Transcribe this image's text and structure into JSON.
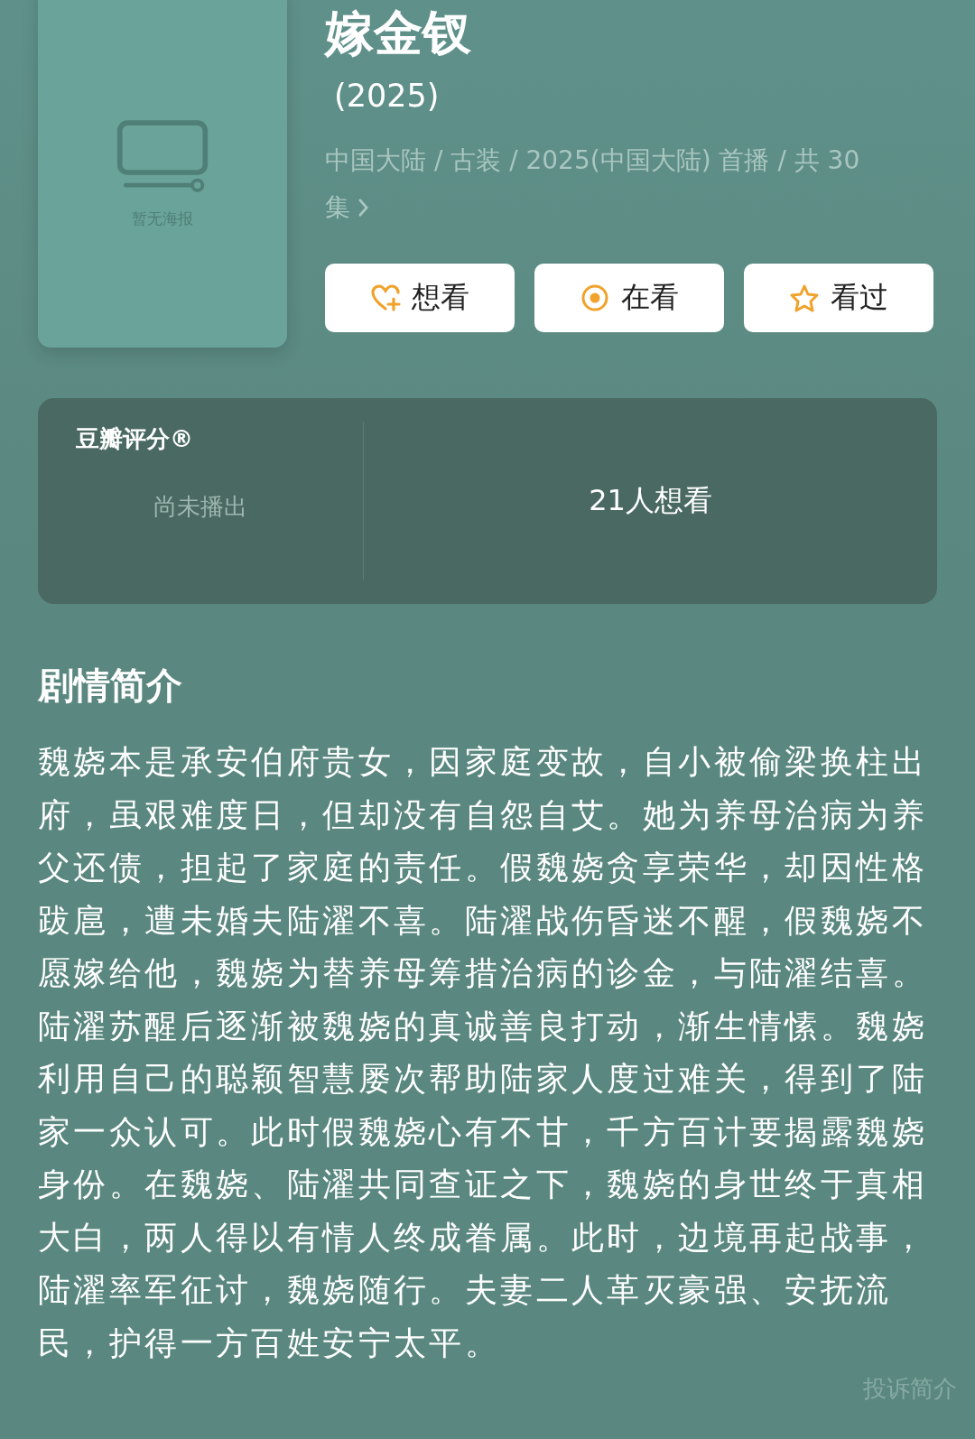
{
  "poster": {
    "placeholder": "暂无海报"
  },
  "title": "嫁金钗",
  "year": "(2025)",
  "meta": "中国大陆 / 古装 / 2025(中国大陆) 首播 / 共 30 集",
  "actions": [
    {
      "label": "想看",
      "kind": "heart"
    },
    {
      "label": "在看",
      "kind": "dot"
    },
    {
      "label": "看过",
      "kind": "star"
    }
  ],
  "rating": {
    "label": "豆瓣评分®",
    "status": "尚未播出",
    "wish_count": "21人想看"
  },
  "synopsis": {
    "heading": "剧情简介",
    "text": "魏娆本是承安伯府贵女，因家庭变故，自小被偷梁换柱出府，虽艰难度日，但却没有自怨自艾。她为养母治病为养父还债，担起了家庭的责任。假魏娆贪享荣华，却因性格跋扈，遭未婚夫陆濯不喜。陆濯战伤昏迷不醒，假魏娆不愿嫁给他，魏娆为替养母筹措治病的诊金，与陆濯结喜。陆濯苏醒后逐渐被魏娆的真诚善良打动，渐生情愫。魏娆利用自己的聪颖智慧屡次帮助陆家人度过难关，得到了陆家一众认可。此时假魏娆心有不甘，千方百计要揭露魏娆身份。在魏娆、陆濯共同查证之下，魏娆的身世终于真相大白，两人得以有情人终成眷属。此时，边境再起战事，陆濯率军征讨，魏娆随行。夫妻二人革灭豪强、安抚流民，护得一方百姓安宁太平。",
    "report_link": "投诉简介"
  }
}
